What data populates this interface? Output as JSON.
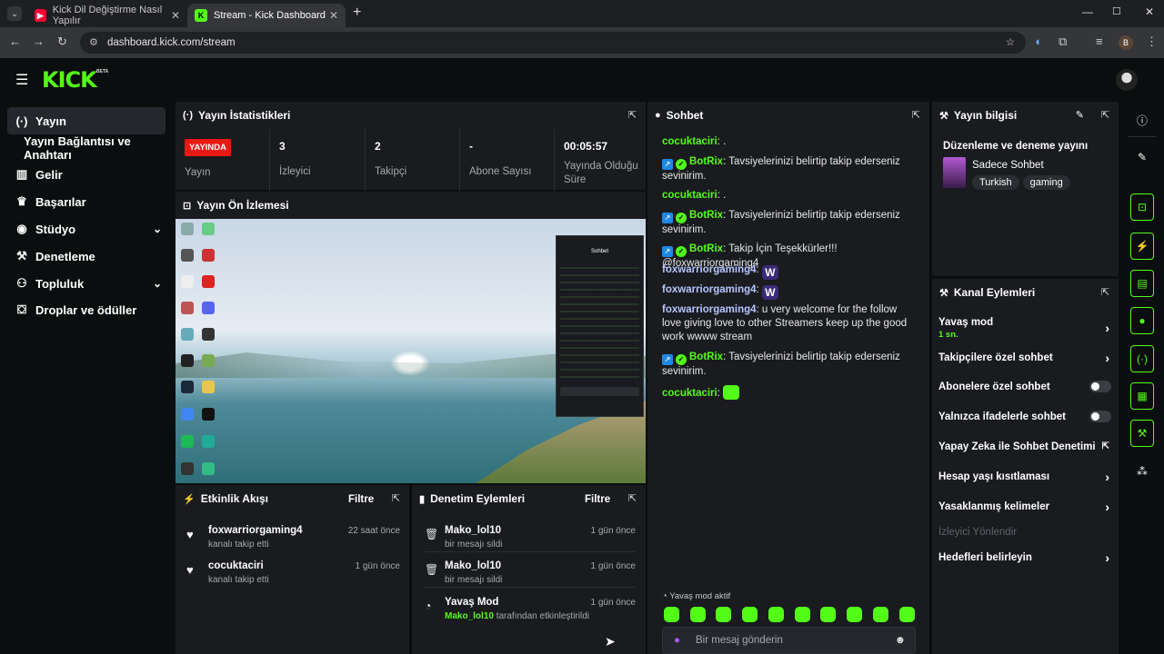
{
  "browser": {
    "tabs": [
      {
        "label": "Kick Dil Değiştirme Nasıl Yapılır",
        "favicon": "youtube-icon"
      },
      {
        "label": "Stream - Kick Dashboard",
        "favicon": "kick-icon"
      }
    ],
    "url": "dashboard.kick.com/stream",
    "profile_initial": "B"
  },
  "header": {
    "logo": "KICK",
    "beta": "BETA"
  },
  "sidebar": {
    "items": [
      {
        "label": "Yayın",
        "icon": "broadcast-icon"
      },
      {
        "label": "Yayın Bağlantısı ve Anahtarı",
        "icon": ""
      },
      {
        "label": "Gelir",
        "icon": "chart-icon"
      },
      {
        "label": "Başarılar",
        "icon": "trophy-icon"
      },
      {
        "label": "Stüdyo",
        "icon": "palette-icon"
      },
      {
        "label": "Denetleme",
        "icon": "wrench-icon"
      },
      {
        "label": "Topluluk",
        "icon": "users-icon"
      },
      {
        "label": "Droplar ve ödüller",
        "icon": "gift-icon"
      }
    ]
  },
  "stats": {
    "title": "Yayın İstatistikleri",
    "live_badge": "YAYINDA",
    "live_label": "Yayın",
    "viewers_value": "3",
    "viewers_label": "İzleyici",
    "followers_value": "2",
    "followers_label": "Takipçi",
    "subs_value": "-",
    "subs_label": "Abone Sayısı",
    "duration_value": "00:05:57",
    "duration_label": "Yayında Olduğu Süre"
  },
  "preview": {
    "title": "Yayın Ön İzlemesi",
    "mini_chat_title": "Sohbet"
  },
  "activity": {
    "title": "Etkinlik Akışı",
    "filter": "Filtre",
    "items": [
      {
        "name": "foxwarriorgaming4",
        "text": "kanalı takip etti",
        "time": "22 saat önce"
      },
      {
        "name": "cocuktaciri",
        "text": "kanalı takip etti",
        "time": "1 gün önce"
      }
    ]
  },
  "moderation": {
    "title": "Denetim Eylemleri",
    "filter": "Filtre",
    "items": [
      {
        "name": "Mako_lol10",
        "text": "bir mesajı sildi",
        "time": "1 gün önce"
      },
      {
        "name": "Mako_lol10",
        "text": "bir mesajı sildi",
        "time": "1 gün önce"
      },
      {
        "name": "Yavaş Mod",
        "user": "Mako_lol10",
        "text": "tarafından etkinleştirildi",
        "time": "1 gün önce"
      }
    ]
  },
  "chat": {
    "title": "Sohbet",
    "messages": [
      {
        "user": "cocuktaciri",
        "text": "."
      },
      {
        "user": "BotRix",
        "text": "Tavsiyelerinizi belirtip takip ederseniz sevinirim."
      },
      {
        "user": "cocuktaciri",
        "text": "."
      },
      {
        "user": "BotRix",
        "text": "Tavsiyelerinizi belirtip takip ederseniz sevinirim."
      },
      {
        "user": "BotRix",
        "text": "Takip İçin Teşekkürler!!! @foxwarriorgaming4"
      },
      {
        "user": "foxwarriorgaming4",
        "text": ""
      },
      {
        "user": "foxwarriorgaming4",
        "text": ""
      },
      {
        "user": "foxwarriorgaming4",
        "text": "u very welcome for the follow love giving love to other Streamers keep up the good work wwww stream"
      },
      {
        "user": "BotRix",
        "text": "Tavsiyelerinizi belirtip takip ederseniz sevinirim."
      },
      {
        "user": "cocuktaciri",
        "text": ""
      }
    ],
    "slow_mode": "Yavaş mod aktif",
    "input_placeholder": "Bir mesaj gönderin"
  },
  "stream_info": {
    "title": "Yayın bilgisi",
    "stream_title": "Düzenleme ve deneme yayını",
    "category": "Sadece Sohbet",
    "tags": [
      "Turkish",
      "gaming"
    ]
  },
  "channel_actions": {
    "title": "Kanal Eylemleri",
    "slow_mode": "Yavaş mod",
    "slow_mode_value": "1 sn.",
    "followers_only": "Takipçilere özel sohbet",
    "subscribers_only": "Abonelere özel sohbet",
    "emotes_only": "Yalnızca ifadelerle sohbet",
    "ai_moderation": "Yapay Zeka ile Sohbet Denetimi",
    "age_restriction": "Hesap yaşı kısıtlaması",
    "banned_words": "Yasaklanmış kelimeler",
    "raid": "İzleyici Yönlendir",
    "goals": "Hedefleri belirleyin"
  },
  "colors": {
    "accent": "#53fc18",
    "live": "#e91916",
    "panel": "#191b1f"
  }
}
